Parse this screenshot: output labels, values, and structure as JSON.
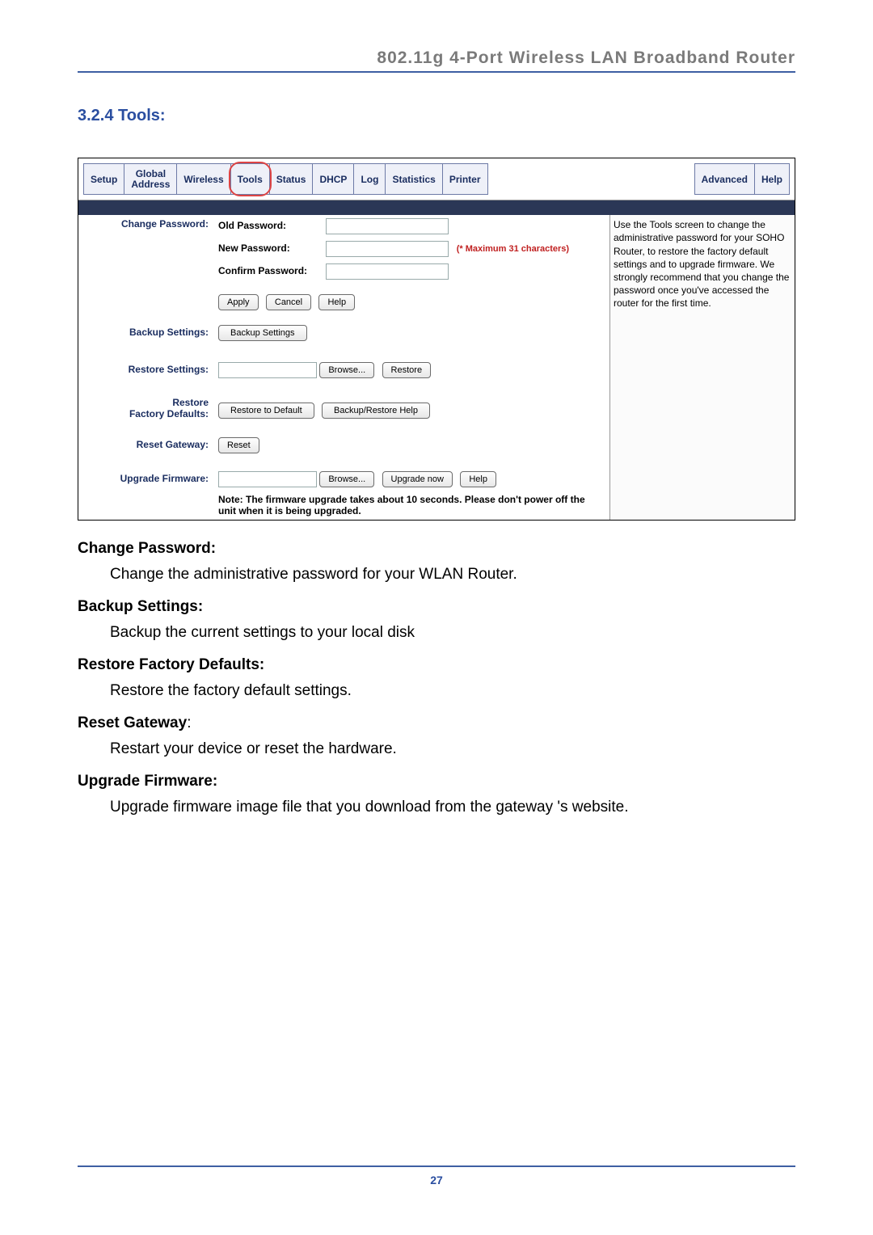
{
  "header": {
    "title": "802.11g 4-Port Wireless LAN Broadband Router"
  },
  "section": {
    "heading": "3.2.4 Tools:"
  },
  "tabs": {
    "left": [
      "Setup",
      "Global\nAddress",
      "Wireless",
      "Tools",
      "Status",
      "DHCP",
      "Log",
      "Statistics",
      "Printer"
    ],
    "right": [
      "Advanced",
      "Help"
    ],
    "active": "Tools"
  },
  "help_text": "Use the Tools screen to change the administrative password for your SOHO Router, to restore the factory default settings and to upgrade firmware. We strongly recommend that you change the password once you've accessed the router for the first time.",
  "rows": {
    "change_password": {
      "label": "Change Password:",
      "fields": {
        "old": "Old Password:",
        "new": "New Password:",
        "confirm": "Confirm Password:"
      },
      "hint": "(* Maximum 31 characters)",
      "buttons": {
        "apply": "Apply",
        "cancel": "Cancel",
        "help": "Help"
      }
    },
    "backup_settings": {
      "label": "Backup Settings:",
      "button": "Backup Settings"
    },
    "restore_settings": {
      "label": "Restore Settings:",
      "buttons": {
        "browse": "Browse...",
        "restore": "Restore"
      }
    },
    "restore_defaults": {
      "label": "Restore\nFactory Defaults:",
      "buttons": {
        "restore": "Restore to Default",
        "help": "Backup/Restore Help"
      }
    },
    "reset_gateway": {
      "label": "Reset Gateway:",
      "button": "Reset"
    },
    "upgrade_firmware": {
      "label": "Upgrade Firmware:",
      "buttons": {
        "browse": "Browse...",
        "upgrade": "Upgrade now",
        "help": "Help"
      }
    },
    "note": "Note: The firmware upgrade takes about 10 seconds. Please don't power off the unit when it is being upgraded."
  },
  "descriptions": {
    "change_password": {
      "h": "Change Password:",
      "t": "Change the administrative password for your WLAN Router."
    },
    "backup_settings": {
      "h": "Backup Settings:",
      "t": "Backup the current settings to your local disk"
    },
    "restore_defaults": {
      "h": "Restore Factory Defaults:",
      "t": "Restore the factory default settings."
    },
    "reset_gateway": {
      "h": "Reset Gateway",
      "col": ":",
      "t": "Restart your device or reset the hardware."
    },
    "upgrade_firmware": {
      "h": "Upgrade Firmware:",
      "t": "Upgrade firmware image file that you download from the gateway 's website."
    }
  },
  "page_number": "27"
}
